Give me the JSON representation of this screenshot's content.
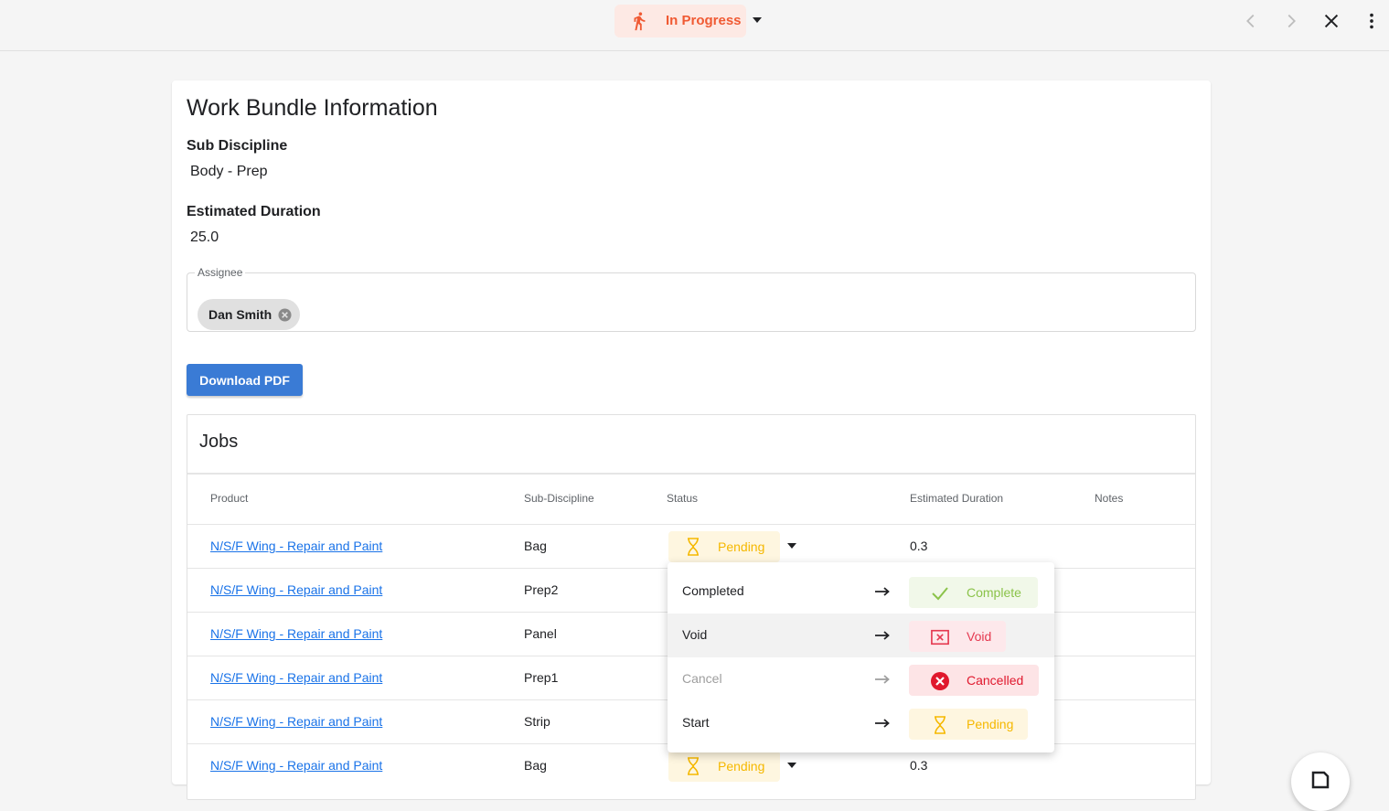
{
  "header": {
    "status_label": "In Progress",
    "status_color": "#f05a33"
  },
  "card": {
    "title": "Work Bundle Information",
    "sub_discipline_label": "Sub Discipline",
    "sub_discipline_value": "Body - Prep",
    "estimated_duration_label": "Estimated Duration",
    "estimated_duration_value": "25.0",
    "assignee_legend": "Assignee",
    "assignee_name": "Dan Smith",
    "download_button": "Download PDF"
  },
  "jobs": {
    "title": "Jobs",
    "columns": [
      "Product",
      "Sub-Discipline",
      "Status",
      "Estimated Duration",
      "Notes"
    ],
    "rows": [
      {
        "product": "N/S/F Wing - Repair and Paint",
        "sub": "Bag",
        "status": "Pending",
        "duration": "0.3"
      },
      {
        "product": "N/S/F Wing - Repair and Paint",
        "sub": "Prep2",
        "status": "",
        "duration": ""
      },
      {
        "product": "N/S/F Wing - Repair and Paint",
        "sub": "Panel",
        "status": "",
        "duration": ""
      },
      {
        "product": "N/S/F Wing - Repair and Paint",
        "sub": "Prep1",
        "status": "",
        "duration": ""
      },
      {
        "product": "N/S/F Wing - Repair and Paint",
        "sub": "Strip",
        "status": "",
        "duration": ""
      },
      {
        "product": "N/S/F Wing - Repair and Paint",
        "sub": "Bag",
        "status": "Pending",
        "duration": "0.3"
      }
    ]
  },
  "status_menu": {
    "items": [
      {
        "action": "Completed",
        "target": "Complete",
        "target_icon": "check-icon",
        "color": "#8bc34a",
        "bg": "#f1f8e9",
        "disabled": false
      },
      {
        "action": "Void",
        "target": "Void",
        "target_icon": "void-box-icon",
        "color": "#e53950",
        "bg": "#fde8eb",
        "disabled": false
      },
      {
        "action": "Cancel",
        "target": "Cancelled",
        "target_icon": "cancel-circle-icon",
        "color": "#e0182d",
        "bg": "#fde4e6",
        "disabled": true
      },
      {
        "action": "Start",
        "target": "Pending",
        "target_icon": "hourglass-icon",
        "color": "#f5b800",
        "bg": "#fef6e0",
        "disabled": false
      }
    ]
  }
}
